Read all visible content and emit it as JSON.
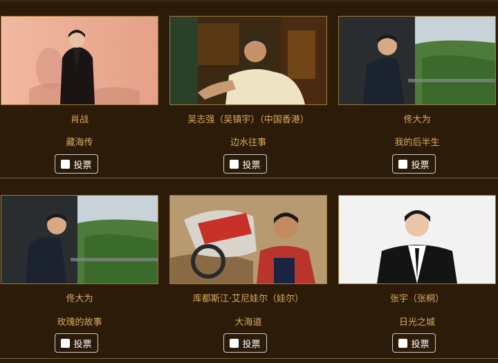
{
  "candidates": [
    {
      "name": "肖战",
      "work": "藏海传",
      "vote_label": "投票",
      "photo": "portrait-xiao-zhan"
    },
    {
      "name": "吴志强（吴镇宇）（中国香港）",
      "work": "边水往事",
      "vote_label": "投票",
      "photo": "portrait-wu-zhenyu"
    },
    {
      "name": "佟大为",
      "work": "我的后半生",
      "vote_label": "投票",
      "photo": "portrait-tong-dawei-balcony"
    },
    {
      "name": "佟大为",
      "work": "玫瑰的故事",
      "vote_label": "投票",
      "photo": "portrait-tong-dawei-balcony"
    },
    {
      "name": "库都斯江·艾尼娃尔（娃尔）",
      "work": "大海道",
      "vote_label": "投票",
      "photo": "portrait-motorcycle-rider"
    },
    {
      "name": "张宇（张桐）",
      "work": "日光之城",
      "vote_label": "投票",
      "photo": "portrait-zhang-tong"
    }
  ],
  "colors": {
    "background": "#2c1b09",
    "text_gold": "#d8ab5a",
    "photo_border": "#a07a3a",
    "button_border": "#cfcfcf"
  }
}
